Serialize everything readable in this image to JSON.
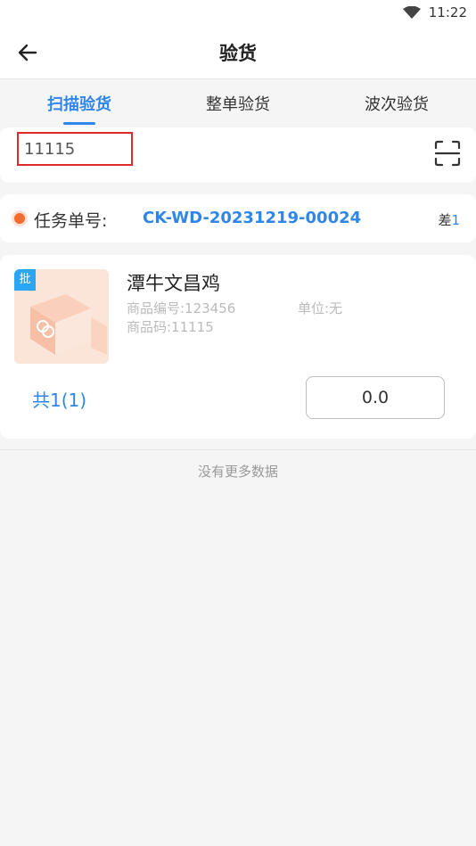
{
  "status_bar": {
    "time": "11:22",
    "wifi_icon": "wifi-icon"
  },
  "header": {
    "title": "验货",
    "back_icon": "arrow-left-icon"
  },
  "tabs": [
    {
      "label": "扫描验货",
      "active": true
    },
    {
      "label": "整单验货",
      "active": false
    },
    {
      "label": "波次验货",
      "active": false
    }
  ],
  "scan": {
    "value": "11115",
    "scan_icon": "scan-icon"
  },
  "task": {
    "label": "任务单号:",
    "number": "CK-WD-20231219-00024",
    "diff_label": "差",
    "diff_value": "1"
  },
  "item": {
    "badge": "批",
    "name": "潭牛文昌鸡",
    "code_label": "商品编号:123456",
    "unit_label": "单位:无",
    "barcode_label": "商品码:11115",
    "count": "共1(1)",
    "quantity": "0.0"
  },
  "footer": {
    "no_more": "没有更多数据"
  },
  "colors": {
    "accent": "#2f86ea",
    "dot": "#f26b30",
    "highlight_border": "#e02a2a"
  }
}
